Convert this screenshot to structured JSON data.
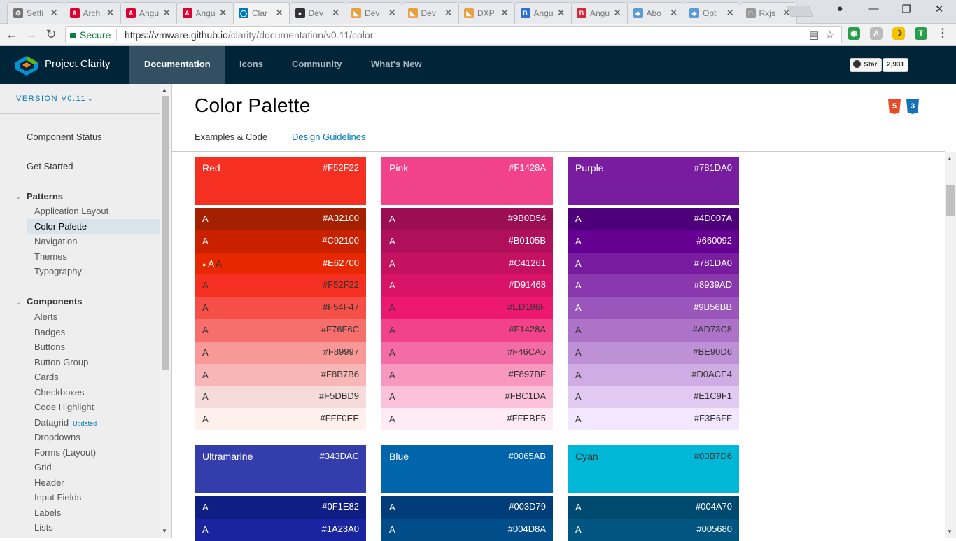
{
  "browser": {
    "tabs": [
      {
        "label": "Setti",
        "icon": "gear",
        "color": "#757575"
      },
      {
        "label": "Arch",
        "icon": "angular",
        "color": "#dd0031"
      },
      {
        "label": "Angu",
        "icon": "angular",
        "color": "#dd0031"
      },
      {
        "label": "Angu",
        "icon": "angular",
        "color": "#dd0031"
      },
      {
        "label": "Clar",
        "icon": "clarity",
        "color": "#0079b8",
        "active": true
      },
      {
        "label": "Dev",
        "icon": "github",
        "color": "#333333"
      },
      {
        "label": "Dev",
        "icon": "folder",
        "color": "#e8a040"
      },
      {
        "label": "Dev",
        "icon": "folder",
        "color": "#e8a040"
      },
      {
        "label": "DXP",
        "icon": "folder",
        "color": "#e8a040"
      },
      {
        "label": "Angu",
        "icon": "bootstrap",
        "color": "#2f6fd6"
      },
      {
        "label": "Angu",
        "icon": "bootstrap-red",
        "color": "#d6283c"
      },
      {
        "label": "Abo",
        "icon": "stack",
        "color": "#5a9bd5"
      },
      {
        "label": "Opt",
        "icon": "stack",
        "color": "#5a9bd5"
      },
      {
        "label": "Rxjs",
        "icon": "doc",
        "color": "#999999"
      }
    ],
    "secure_label": "Secure",
    "url_host": "https://vmware.github.io",
    "url_path": "/clarity/documentation/v0.11/color"
  },
  "header": {
    "brand": "Project Clarity",
    "nav": [
      "Documentation",
      "Icons",
      "Community",
      "What's New"
    ],
    "active_nav": "Documentation",
    "github_star": "Star",
    "github_count": "2,931"
  },
  "sidebar": {
    "version": "VERSION V0.11",
    "top_items": [
      "Component Status",
      "Get Started"
    ],
    "patterns": {
      "label": "Patterns",
      "items": [
        "Application Layout",
        "Color Palette",
        "Navigation",
        "Themes",
        "Typography"
      ],
      "selected": "Color Palette"
    },
    "components": {
      "label": "Components",
      "items": [
        "Alerts",
        "Badges",
        "Buttons",
        "Button Group",
        "Cards",
        "Checkboxes",
        "Code Highlight",
        "Datagrid",
        "Dropdowns",
        "Forms (Layout)",
        "Grid",
        "Header",
        "Input Fields",
        "Labels",
        "Lists"
      ],
      "updated_item": "Datagrid",
      "updated_badge": "Updated"
    }
  },
  "page": {
    "title": "Color Palette",
    "tabs": [
      "Examples & Code",
      "Design Guidelines"
    ],
    "active_tab": "Examples & Code",
    "tech_badges": [
      "5",
      "3"
    ]
  },
  "palettes": [
    {
      "name": "Red",
      "hex": "#F52F22",
      "color": "#F52F22",
      "shades": [
        {
          "label": "A",
          "hex": "#A32100",
          "color": "#A32100",
          "text": "light"
        },
        {
          "label": "A",
          "hex": "#C92100",
          "color": "#C92100",
          "text": "light"
        },
        {
          "label": "• A A",
          "hex": "#E62700",
          "color": "#E62700",
          "text": "light",
          "mixed": true
        },
        {
          "label": "A",
          "hex": "#F52F22",
          "color": "#F52F22",
          "text": "dark"
        },
        {
          "label": "A",
          "hex": "#F54F47",
          "color": "#F54F47",
          "text": "dark"
        },
        {
          "label": "A",
          "hex": "#F76F6C",
          "color": "#F76F6C",
          "text": "dark"
        },
        {
          "label": "A",
          "hex": "#F89997",
          "color": "#F89997",
          "text": "dark"
        },
        {
          "label": "A",
          "hex": "#F8B7B6",
          "color": "#F8B7B6",
          "text": "dark"
        },
        {
          "label": "A",
          "hex": "#F5DBD9",
          "color": "#F5DBD9",
          "text": "dark"
        },
        {
          "label": "A",
          "hex": "#FFF0EE",
          "color": "#FFF0EE",
          "text": "dark"
        }
      ]
    },
    {
      "name": "Pink",
      "hex": "#F1428A",
      "color": "#F1428A",
      "shades": [
        {
          "label": "A",
          "hex": "#9B0D54",
          "color": "#9B0D54",
          "text": "light"
        },
        {
          "label": "A",
          "hex": "#B0105B",
          "color": "#B0105B",
          "text": "light"
        },
        {
          "label": "A",
          "hex": "#C41261",
          "color": "#C41261",
          "text": "light"
        },
        {
          "label": "A",
          "hex": "#D91468",
          "color": "#D91468",
          "text": "light"
        },
        {
          "label": "A",
          "hex": "#ED186F",
          "color": "#ED186F",
          "text": "dark"
        },
        {
          "label": "A",
          "hex": "#F1428A",
          "color": "#F1428A",
          "text": "dark"
        },
        {
          "label": "A",
          "hex": "#F46CA5",
          "color": "#F46CA5",
          "text": "dark"
        },
        {
          "label": "A",
          "hex": "#F897BF",
          "color": "#F897BF",
          "text": "dark"
        },
        {
          "label": "A",
          "hex": "#FBC1DA",
          "color": "#FBC1DA",
          "text": "dark"
        },
        {
          "label": "A",
          "hex": "#FFEBF5",
          "color": "#FFEBF5",
          "text": "dark"
        }
      ]
    },
    {
      "name": "Purple",
      "hex": "#781DA0",
      "color": "#781DA0",
      "shades": [
        {
          "label": "A",
          "hex": "#4D007A",
          "color": "#4D007A",
          "text": "light"
        },
        {
          "label": "A",
          "hex": "#660092",
          "color": "#660092",
          "text": "light"
        },
        {
          "label": "A",
          "hex": "#781DA0",
          "color": "#781DA0",
          "text": "light"
        },
        {
          "label": "A",
          "hex": "#8939AD",
          "color": "#8939AD",
          "text": "light"
        },
        {
          "label": "A",
          "hex": "#9B56BB",
          "color": "#9B56BB",
          "text": "light"
        },
        {
          "label": "A",
          "hex": "#AD73C8",
          "color": "#AD73C8",
          "text": "dark"
        },
        {
          "label": "A",
          "hex": "#BE90D6",
          "color": "#BE90D6",
          "text": "dark"
        },
        {
          "label": "A",
          "hex": "#D0ACE4",
          "color": "#D0ACE4",
          "text": "dark"
        },
        {
          "label": "A",
          "hex": "#E1C9F1",
          "color": "#E1C9F1",
          "text": "dark"
        },
        {
          "label": "A",
          "hex": "#F3E6FF",
          "color": "#F3E6FF",
          "text": "dark"
        }
      ]
    },
    {
      "name": "Ultramarine",
      "hex": "#343DAC",
      "color": "#343DAC",
      "shades": [
        {
          "label": "A",
          "hex": "#0F1E82",
          "color": "#0F1E82",
          "text": "light"
        },
        {
          "label": "A",
          "hex": "#1A23A0",
          "color": "#1A23A0",
          "text": "light"
        }
      ]
    },
    {
      "name": "Blue",
      "hex": "#0065AB",
      "color": "#0065AB",
      "shades": [
        {
          "label": "A",
          "hex": "#003D79",
          "color": "#003D79",
          "text": "light"
        },
        {
          "label": "A",
          "hex": "#004D8A",
          "color": "#004D8A",
          "text": "light"
        }
      ]
    },
    {
      "name": "Cyan",
      "hex": "#00B7D6",
      "color": "#00B7D6",
      "head_text": "dark",
      "shades": [
        {
          "label": "A",
          "hex": "#004A70",
          "color": "#004A70",
          "text": "light"
        },
        {
          "label": "A",
          "hex": "#005680",
          "color": "#005680",
          "text": "light"
        }
      ]
    }
  ]
}
